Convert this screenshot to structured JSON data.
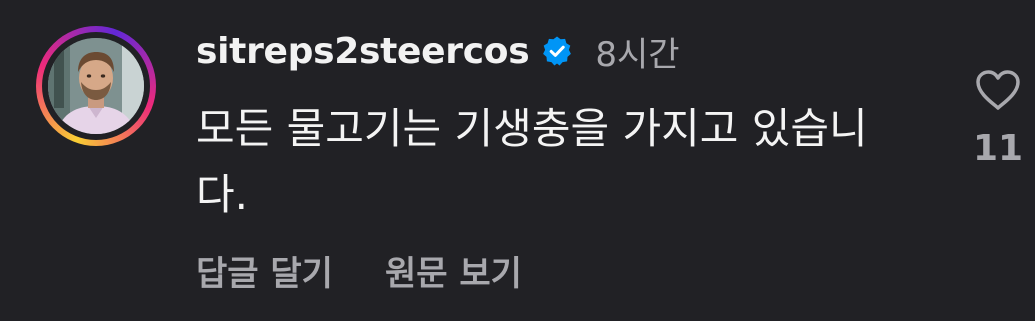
{
  "comment": {
    "username": "sitreps2steercos",
    "time": "8시간",
    "text": "모든 물고기는 기생충을 가지고 있습니다.",
    "verified_icon": "verified-badge-icon",
    "avatar_ring_colors": [
      "#f9ce34",
      "#ee2a7b",
      "#6228d7"
    ]
  },
  "actions": {
    "reply_label": "답글 달기",
    "translate_label": "원문 보기"
  },
  "like": {
    "icon": "heart-outline-icon",
    "count": "11"
  },
  "colors": {
    "background": "#212125",
    "primary_text": "#f4f4f4",
    "secondary_text": "#a8a8ad",
    "verified": "#0095f6"
  }
}
